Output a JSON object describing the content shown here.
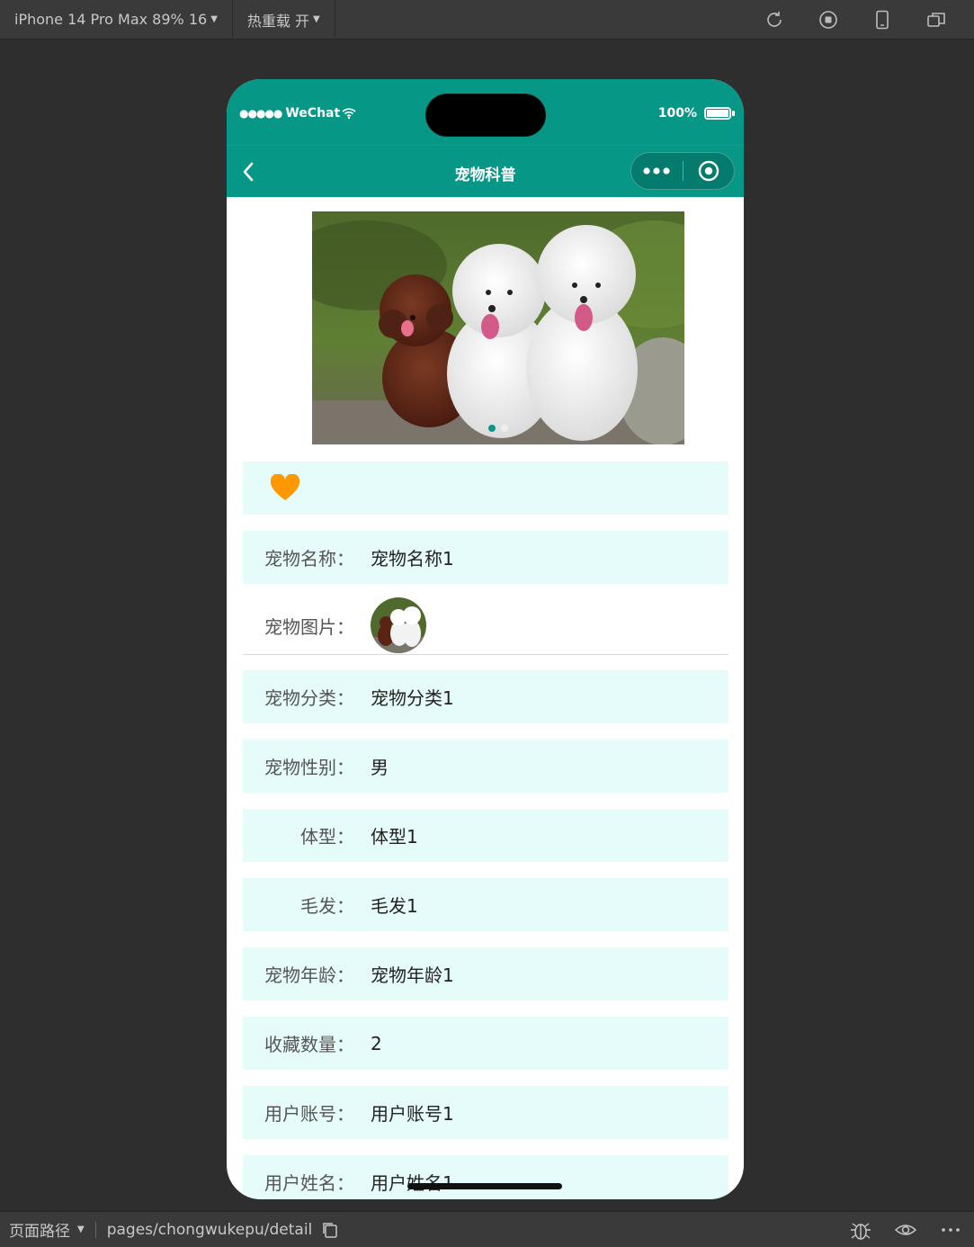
{
  "toolbar": {
    "device_label": "iPhone 14 Pro Max 89% 16",
    "hot_reload_label": "热重载 开"
  },
  "status_bar": {
    "carrier": "WeChat",
    "battery": "100%"
  },
  "navbar": {
    "title": "宠物科普"
  },
  "swiper": {
    "slide_count": 2,
    "active_index": 0
  },
  "favorite": {
    "icon": "heart-icon",
    "color": "#ff9800"
  },
  "details": [
    {
      "label": "宠物名称",
      "value": "宠物名称1"
    },
    {
      "label": "宠物图片",
      "value": ""
    },
    {
      "label": "宠物分类",
      "value": "宠物分类1"
    },
    {
      "label": "宠物性别",
      "value": "男"
    },
    {
      "label": "体型",
      "value": "体型1"
    },
    {
      "label": "毛发",
      "value": "毛发1"
    },
    {
      "label": "宠物年龄",
      "value": "宠物年龄1"
    },
    {
      "label": "收藏数量",
      "value": "2"
    },
    {
      "label": "用户账号",
      "value": "用户账号1"
    },
    {
      "label": "用户姓名",
      "value": "用户姓名1"
    }
  ],
  "colon": "：",
  "bottom_bar": {
    "path_label": "页面路径",
    "path": "pages/chongwukepu/detail"
  },
  "colors": {
    "primary": "#079787",
    "row_bg": "#e6fcfa",
    "heart": "#ff9800"
  }
}
